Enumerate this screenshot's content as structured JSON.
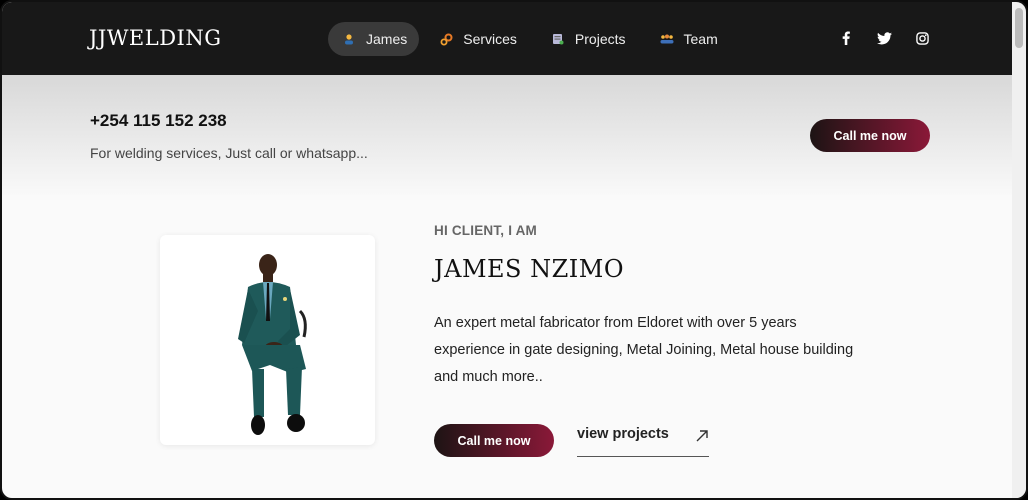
{
  "header": {
    "logo": "JJWELDING",
    "nav": [
      {
        "label": "James",
        "icon": "person-icon",
        "active": true
      },
      {
        "label": "Services",
        "icon": "gears-icon",
        "active": false
      },
      {
        "label": "Projects",
        "icon": "folder-icon",
        "active": false
      },
      {
        "label": "Team",
        "icon": "team-icon",
        "active": false
      }
    ],
    "socials": [
      "facebook-icon",
      "twitter-icon",
      "instagram-icon"
    ]
  },
  "contact": {
    "phone": "+254 115 152 238",
    "tagline": "For welding services, Just call or whatsapp...",
    "call_label": "Call me now"
  },
  "hero": {
    "eyebrow": "HI CLIENT, I AM",
    "name": "JAMES NZIMO",
    "bio": "An expert metal fabricator from Eldoret with over 5 years experience in gate designing, Metal Joining, Metal house building and much more..",
    "call_label": "Call me now",
    "view_label": "view projects"
  },
  "colors": {
    "header_bg": "#181818",
    "accent_start": "#1d1414",
    "accent_end": "#8a1838"
  }
}
